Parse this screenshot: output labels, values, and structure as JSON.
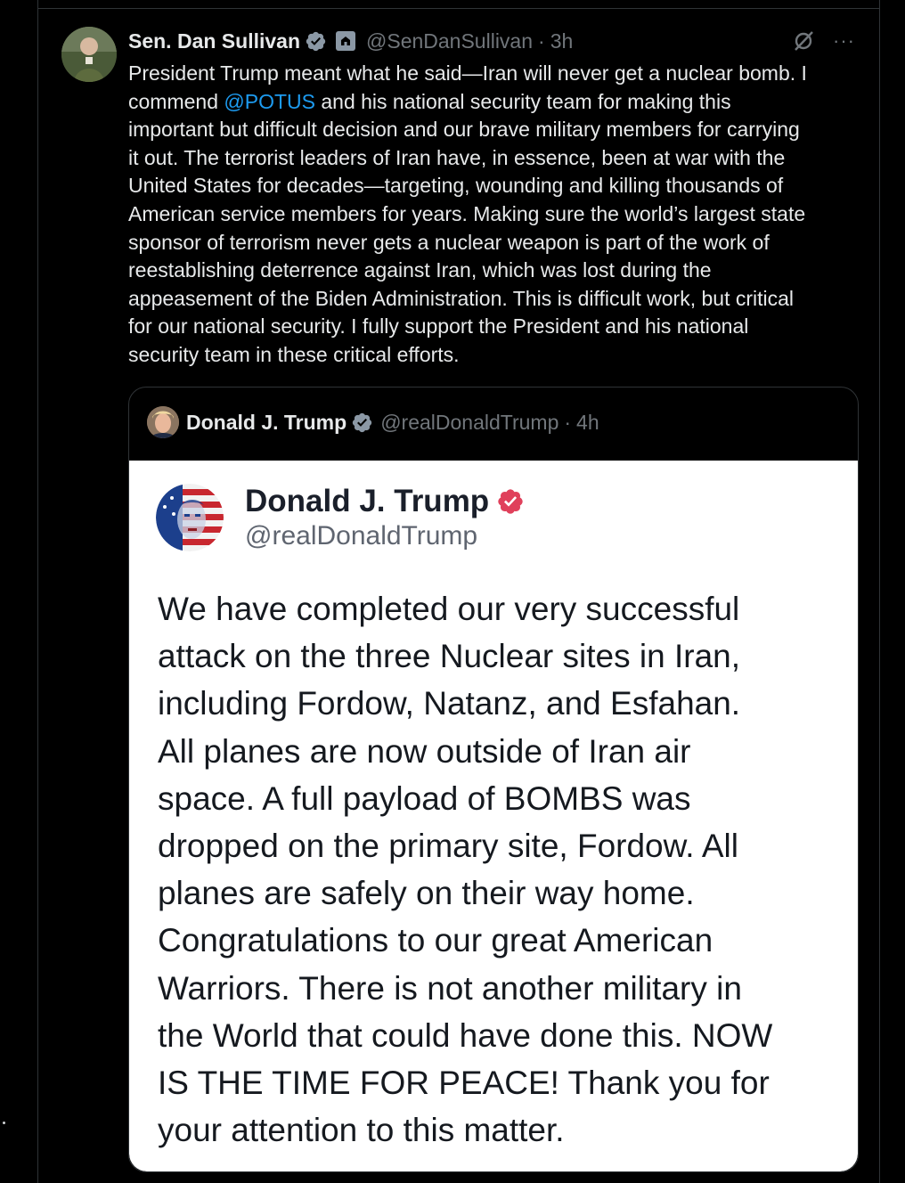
{
  "tweet": {
    "author_name": "Sen. Dan Sullivan",
    "handle": "@SenDanSullivan",
    "separator": "·",
    "time": "3h",
    "more_label": "···",
    "body_lines": [
      "President Trump meant what he said—Iran will never get a nuclear bomb. I",
      "commend ",
      "@POTUS",
      " and his national security team for making this\nimportant but difficult decision and our brave military members for carrying\nit out. The terrorist leaders of Iran have, in essence, been at war with the\nUnited States for decades—targeting, wounding and killing thousands of\nAmerican service members for years. Making sure the world’s largest state\nsponsor of terrorism never gets a nuclear weapon is part of the work of\nreestablishing deterrence against Iran, which was lost during the\nappeasement of the Biden Administration. This is difficult work, but critical\nfor our national security. I fully support the President and his national\nsecurity team in these critical efforts."
    ]
  },
  "quote": {
    "author_name": "Donald J. Trump",
    "handle": "@realDonaldTrump",
    "separator": "·",
    "time": "4h",
    "image": {
      "author_name": "Donald J. Trump",
      "handle": "@realDonaldTrump",
      "text": "We have completed our very successful\nattack on the three Nuclear sites in Iran,\nincluding Fordow, Natanz, and Esfahan.\nAll planes are now outside of Iran air\nspace. A full payload of BOMBS was\ndropped on the primary site, Fordow. All\nplanes are safely on their way home.\nCongratulations to our great American\nWarriors. There is not another military in\nthe World that could have done this. NOW\nIS THE TIME FOR PEACE! Thank you for\nyour attention to this matter."
    }
  },
  "colors": {
    "background": "#000000",
    "text": "#e7e9ea",
    "muted": "#71767b",
    "link": "#1d9bf0",
    "verified": "#8b98a5",
    "truth_badge": "#e0405b"
  },
  "icons": [
    "verified-badge-icon",
    "government-badge-icon",
    "grok-icon",
    "more-icon"
  ]
}
